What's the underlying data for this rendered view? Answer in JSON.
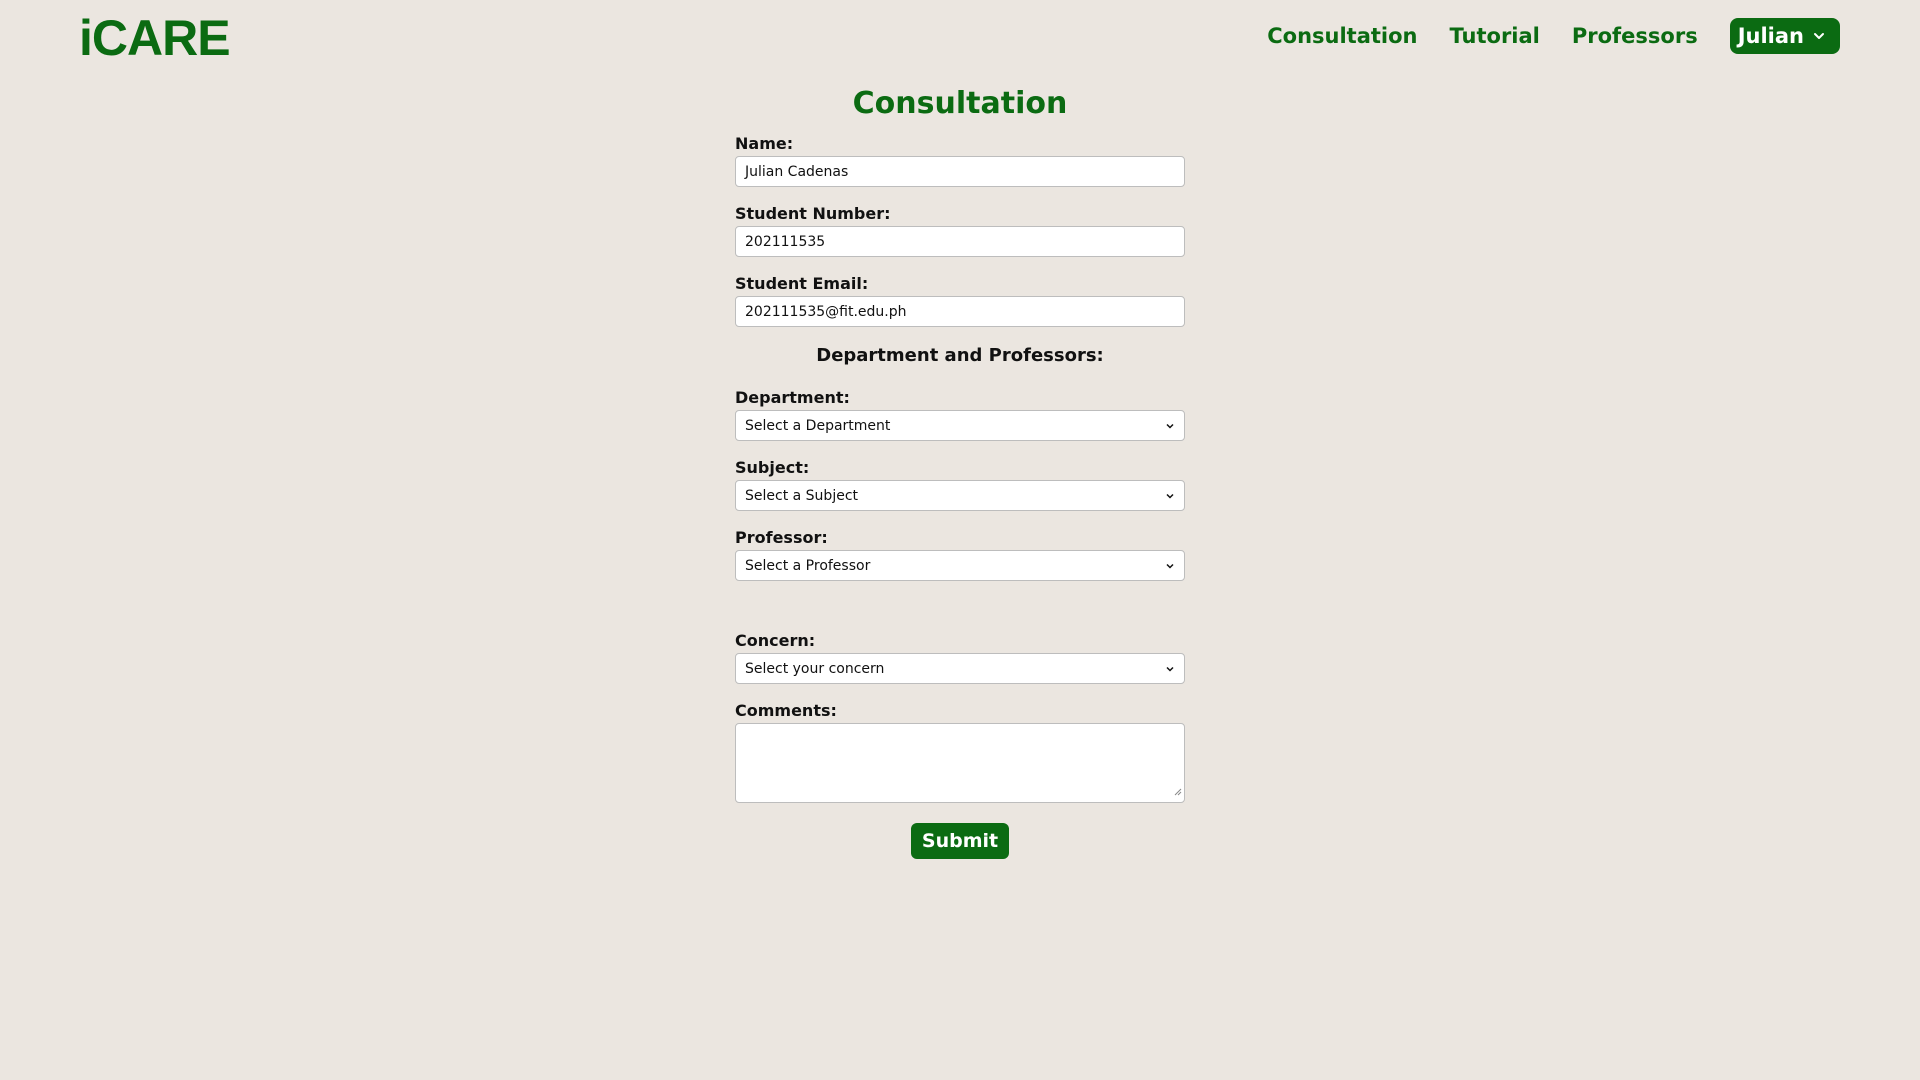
{
  "app": {
    "logo": "iCARE"
  },
  "nav": {
    "items": [
      {
        "label": "Consultation"
      },
      {
        "label": "Tutorial"
      },
      {
        "label": "Professors"
      }
    ],
    "user": {
      "label": "Julian",
      "icon": "chevron-down-icon"
    }
  },
  "form": {
    "title": "Consultation",
    "name": {
      "label": "Name:",
      "value": "Julian Cadenas"
    },
    "student_number": {
      "label": "Student Number:",
      "value": "202111535"
    },
    "student_email": {
      "label": "Student Email:",
      "value": "202111535@fit.edu.ph"
    },
    "section_heading": "Department and Professors:",
    "department": {
      "label": "Department:",
      "value": "Select a Department"
    },
    "subject": {
      "label": "Subject:",
      "value": "Select a Subject"
    },
    "professor": {
      "label": "Professor:",
      "value": "Select a Professor"
    },
    "concern": {
      "label": "Concern:",
      "value": "Select your concern"
    },
    "comments": {
      "label": "Comments:",
      "value": ""
    },
    "submit_label": "Submit"
  },
  "colors": {
    "brand": "#0b6b12",
    "background": "#ebe6e0"
  }
}
